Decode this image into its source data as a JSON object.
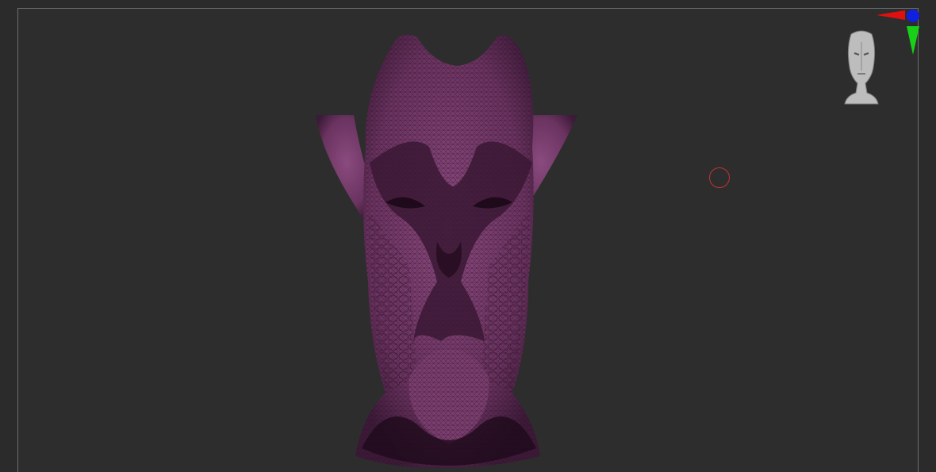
{
  "viewport": {
    "background": "#2d2d2d",
    "border_color": "#6e6e6e"
  },
  "model": {
    "mesh_color": "#7a3e6e",
    "wire_color": "#2a0f24",
    "shadow_color": "#3a1834",
    "icon": "sculpted-head-mesh"
  },
  "brush_cursor": {
    "color": "#c03333",
    "icon": "circle-cursor-icon"
  },
  "axis_gizmo": {
    "x_color": "#e01010",
    "y_color": "#19d019",
    "z_color": "#1020e0"
  },
  "navigator": {
    "icon": "navigation-head-icon",
    "color": "#c8c8c8"
  }
}
